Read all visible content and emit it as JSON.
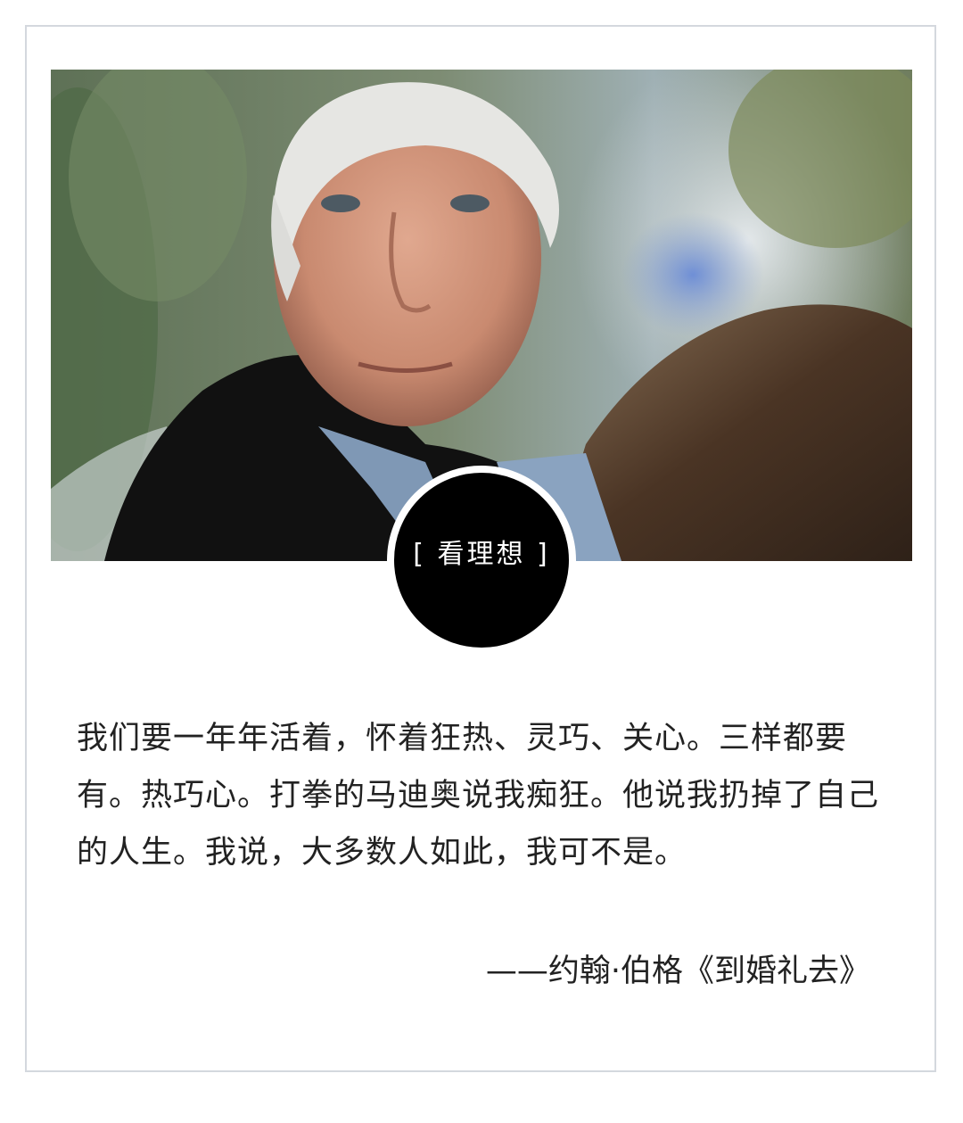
{
  "badge": {
    "label": "[ 看理想 ]"
  },
  "quote": {
    "text": "我们要一年年活着，怀着狂热、灵巧、关心。三样都要有。热巧心。打拳的马迪奥说我痴狂。他说我扔掉了自己的人生。我说，大多数人如此，我可不是。"
  },
  "attribution": {
    "text": "——约翰·伯格《到婚礼去》"
  },
  "colors": {
    "border": "#d4d8de",
    "badge_background": "#000000",
    "badge_text": "#ffffff",
    "body_text": "#222222"
  }
}
